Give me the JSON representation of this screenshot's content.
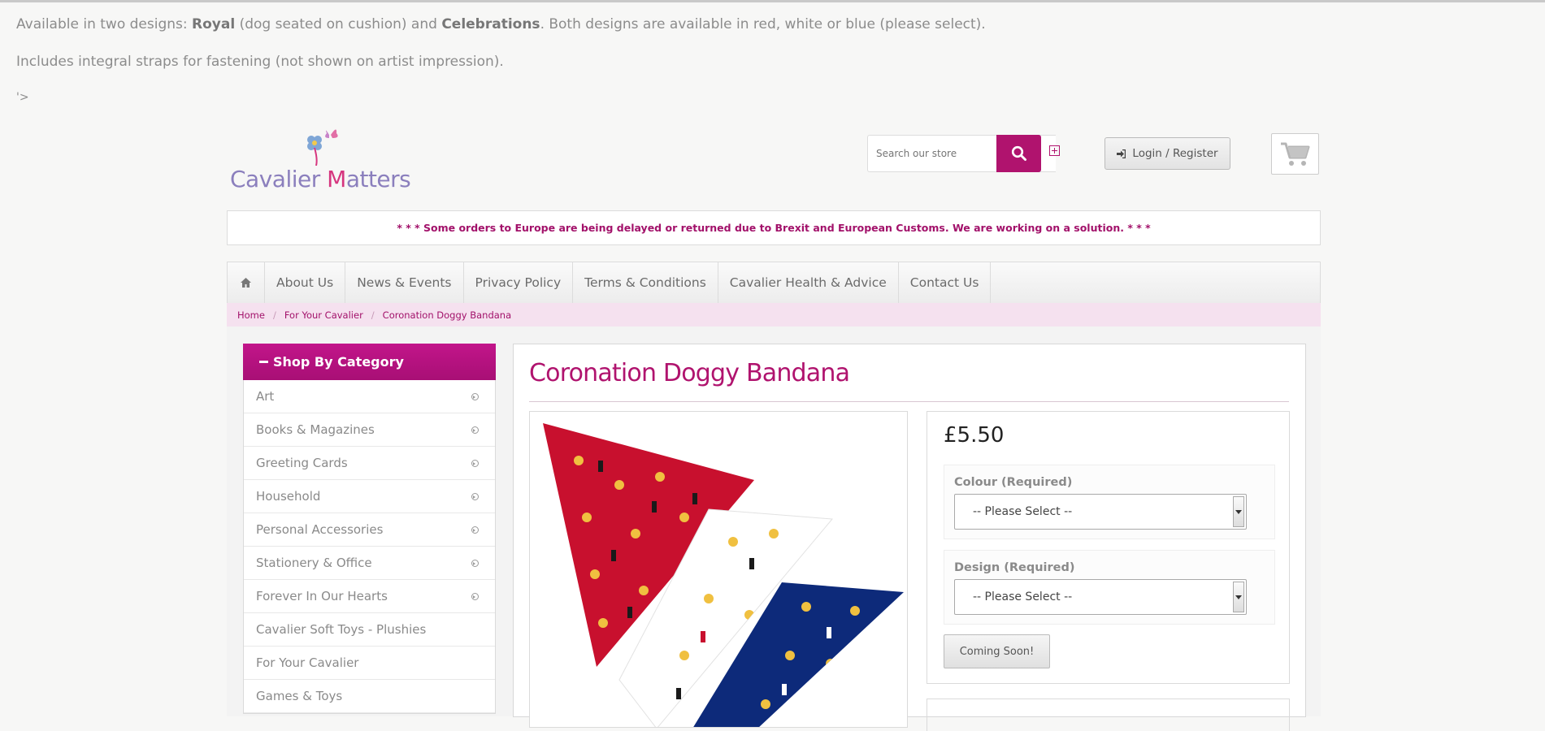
{
  "intro": {
    "line1_prefix": "Available in two designs: ",
    "design1": "Royal",
    "line1_mid": " (dog seated on cushion) and ",
    "design2": "Celebrations",
    "line1_suffix": ". Both designs are available in red, white or blue (please select).",
    "line2": "Includes integral straps for fastening (not shown on artist impression).",
    "line3": "'>"
  },
  "header": {
    "logo_text_pre": "Cavalier ",
    "logo_text_m": "M",
    "logo_text_post": "atters",
    "search_placeholder": "Search our store",
    "login_label": "Login / Register"
  },
  "notice": "* * * Some orders to Europe are being delayed or returned due to Brexit and European Customs. We are working on a solution. * * *",
  "nav": {
    "items": [
      "About Us",
      "News & Events",
      "Privacy Policy",
      "Terms & Conditions",
      "Cavalier Health & Advice",
      "Contact Us"
    ]
  },
  "breadcrumb": [
    "Home",
    "For Your Cavalier",
    "Coronation Doggy Bandana"
  ],
  "sidebar": {
    "title": "Shop By Category",
    "items": [
      {
        "label": "Art",
        "arrow": true
      },
      {
        "label": "Books & Magazines",
        "arrow": true
      },
      {
        "label": "Greeting Cards",
        "arrow": true
      },
      {
        "label": "Household",
        "arrow": true
      },
      {
        "label": "Personal Accessories",
        "arrow": true
      },
      {
        "label": "Stationery & Office",
        "arrow": true
      },
      {
        "label": "Forever In Our Hearts",
        "arrow": true
      },
      {
        "label": "Cavalier Soft Toys - Plushies",
        "arrow": false
      },
      {
        "label": "For Your Cavalier",
        "arrow": false
      },
      {
        "label": "Games & Toys",
        "arrow": false
      }
    ]
  },
  "product": {
    "title": "Coronation Doggy Bandana",
    "price": "£5.50",
    "colour_label": "Colour (Required)",
    "colour_value": "-- Please Select --",
    "design_label": "Design (Required)",
    "design_value": "-- Please Select --",
    "button_label": "Coming Soon!"
  },
  "colors": {
    "brand": "#b0136e",
    "bandana_red": "#c8102e",
    "bandana_blue": "#0d2a7a",
    "bandana_white": "#ffffff"
  }
}
